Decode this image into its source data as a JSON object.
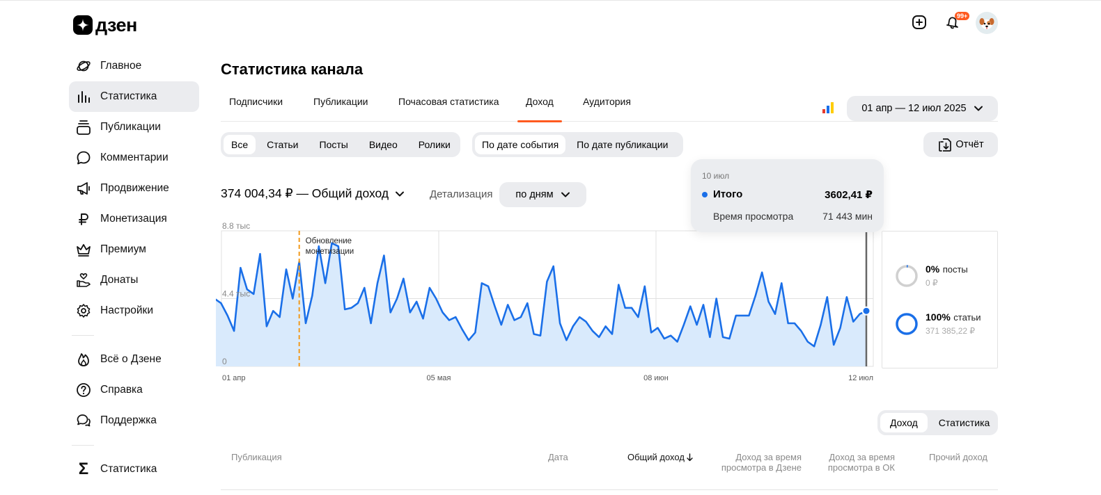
{
  "app": {
    "logo_text": "дзен"
  },
  "topbar": {
    "notifications_badge": "99+"
  },
  "sidebar": {
    "items": [
      {
        "label": "Главное",
        "icon": "planet-icon"
      },
      {
        "label": "Статистика",
        "icon": "bar-chart-icon",
        "active": true
      },
      {
        "label": "Публикации",
        "icon": "layers-icon"
      },
      {
        "label": "Комментарии",
        "icon": "comment-icon"
      },
      {
        "label": "Продвижение",
        "icon": "megaphone-icon"
      },
      {
        "label": "Монетизация",
        "icon": "ruble-icon"
      },
      {
        "label": "Премиум",
        "icon": "crown-icon"
      },
      {
        "label": "Донаты",
        "icon": "donate-icon"
      },
      {
        "label": "Настройки",
        "icon": "gear-icon"
      }
    ],
    "items2": [
      {
        "label": "Всё о Дзене",
        "icon": "flame-icon"
      },
      {
        "label": "Справка",
        "icon": "help-icon"
      },
      {
        "label": "Поддержка",
        "icon": "chat-icon"
      }
    ],
    "items3": [
      {
        "label": "Статистика",
        "icon": "sigma-icon"
      }
    ]
  },
  "main": {
    "title": "Статистика канала",
    "tabs": [
      {
        "label": "Подписчики"
      },
      {
        "label": "Публикации"
      },
      {
        "label": "Почасовая статистика"
      },
      {
        "label": "Доход",
        "active": true
      },
      {
        "label": "Аудитория"
      }
    ],
    "date_range": "01 апр — 12 июл 2025",
    "content_filter": [
      "Все",
      "Статьи",
      "Посты",
      "Видео",
      "Ролики"
    ],
    "date_filter": [
      "По дате события",
      "По дате публикации"
    ],
    "report_label": "Отчёт",
    "total_label": "374 004,34 ₽ — Общий доход",
    "detail_label": "Детализация",
    "detail_value": "по дням",
    "tooltip": {
      "date": "10 июл",
      "label": "Итого",
      "value": "3602,41 ₽",
      "sub_label": "Время просмотра",
      "sub_value": "71 443 мин"
    },
    "breakdown": [
      {
        "pct": "0%",
        "name": "посты",
        "value": "0 ₽",
        "fraction": 0.0
      },
      {
        "pct": "100%",
        "name": "статьи",
        "value": "371 385,22 ₽",
        "fraction": 1.0
      }
    ],
    "table_toggle": [
      "Доход",
      "Статистика"
    ],
    "table_headers": {
      "publication": "Публикация",
      "date": "Дата",
      "total": "Общий доход",
      "dzen_line1": "Доход за время",
      "dzen_line2": "просмотра в Дзене",
      "ok_line1": "Доход за время",
      "ok_line2": "просмотра в ОК",
      "other": "Прочий доход"
    }
  },
  "chart_data": {
    "type": "area",
    "y_tick_labels": [
      "8.8 тыс",
      "4.4 тыс",
      "0"
    ],
    "x_tick_labels": [
      "01 апр",
      "05 мая",
      "08 июн",
      "12 июл"
    ],
    "ylim": [
      0,
      8800
    ],
    "annotation": {
      "text": "Обновление монетизации",
      "x_index": 13
    },
    "highlight_index": 100,
    "grid": true,
    "color": "#1a6fe8",
    "fill": "#d9eafc",
    "values": [
      4400,
      4100,
      3300,
      2300,
      6400,
      5000,
      4700,
      7300,
      2600,
      3600,
      3200,
      6300,
      4400,
      6800,
      2800,
      4600,
      7800,
      5400,
      8000,
      7800,
      3700,
      3800,
      4100,
      5100,
      2800,
      5400,
      7200,
      3500,
      4400,
      5700,
      3500,
      4200,
      3100,
      5100,
      4400,
      3500,
      3000,
      3200,
      2400,
      1700,
      2200,
      5400,
      5200,
      3900,
      2700,
      4000,
      3000,
      3200,
      4100,
      2100,
      2000,
      5500,
      6500,
      2800,
      1700,
      2600,
      3200,
      2900,
      2300,
      1900,
      2600,
      2100,
      5300,
      3800,
      3800,
      3200,
      5200,
      2200,
      2500,
      1800,
      2000,
      1600,
      2700,
      3900,
      2700,
      4000,
      1900,
      4400,
      1900,
      1800,
      3300,
      3300,
      3300,
      4600,
      6100,
      4200,
      3400,
      5400,
      2800,
      2800,
      2300,
      1600,
      1300,
      2700,
      4500,
      1400,
      2500,
      4500,
      2900,
      3400,
      3600
    ]
  }
}
